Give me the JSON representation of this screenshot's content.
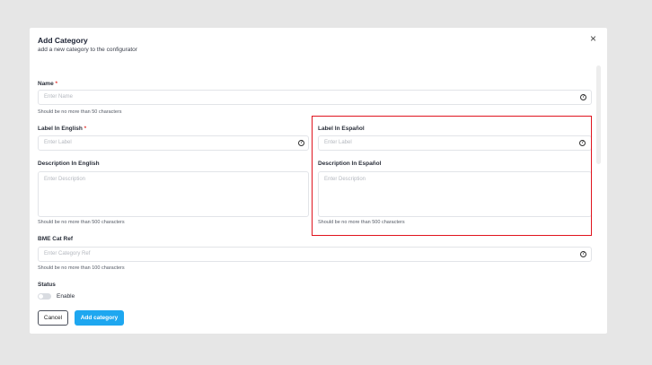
{
  "modal": {
    "title": "Add Category",
    "subtitle": "add a new category to the configurator",
    "close_icon": "×"
  },
  "name": {
    "label": "Name",
    "required_mark": "*",
    "placeholder": "Enter Name",
    "hint": "Should be no more than 50 characters"
  },
  "label_en": {
    "label": "Label In English",
    "required_mark": "*",
    "placeholder": "Enter Label"
  },
  "label_es": {
    "label": "Label In Español",
    "placeholder": "Enter Label"
  },
  "desc_en": {
    "label": "Description In English",
    "placeholder": "Enter Description",
    "hint": "Should be no more than 500 characters"
  },
  "desc_es": {
    "label": "Description In Español",
    "placeholder": "Enter Description",
    "hint": "Should be no more than 500 characters"
  },
  "bme": {
    "label": "BME Cat Ref",
    "placeholder": "Enter Category Ref",
    "hint": "Should be no more than 100 characters"
  },
  "status": {
    "label": "Status",
    "toggle_label": "Enable",
    "enabled": false
  },
  "buttons": {
    "cancel": "Cancel",
    "add": "Add category"
  },
  "icons": {
    "help": "?"
  },
  "colors": {
    "primary": "#1ea7f0",
    "highlight": "#e0141e",
    "required": "#e53935"
  }
}
